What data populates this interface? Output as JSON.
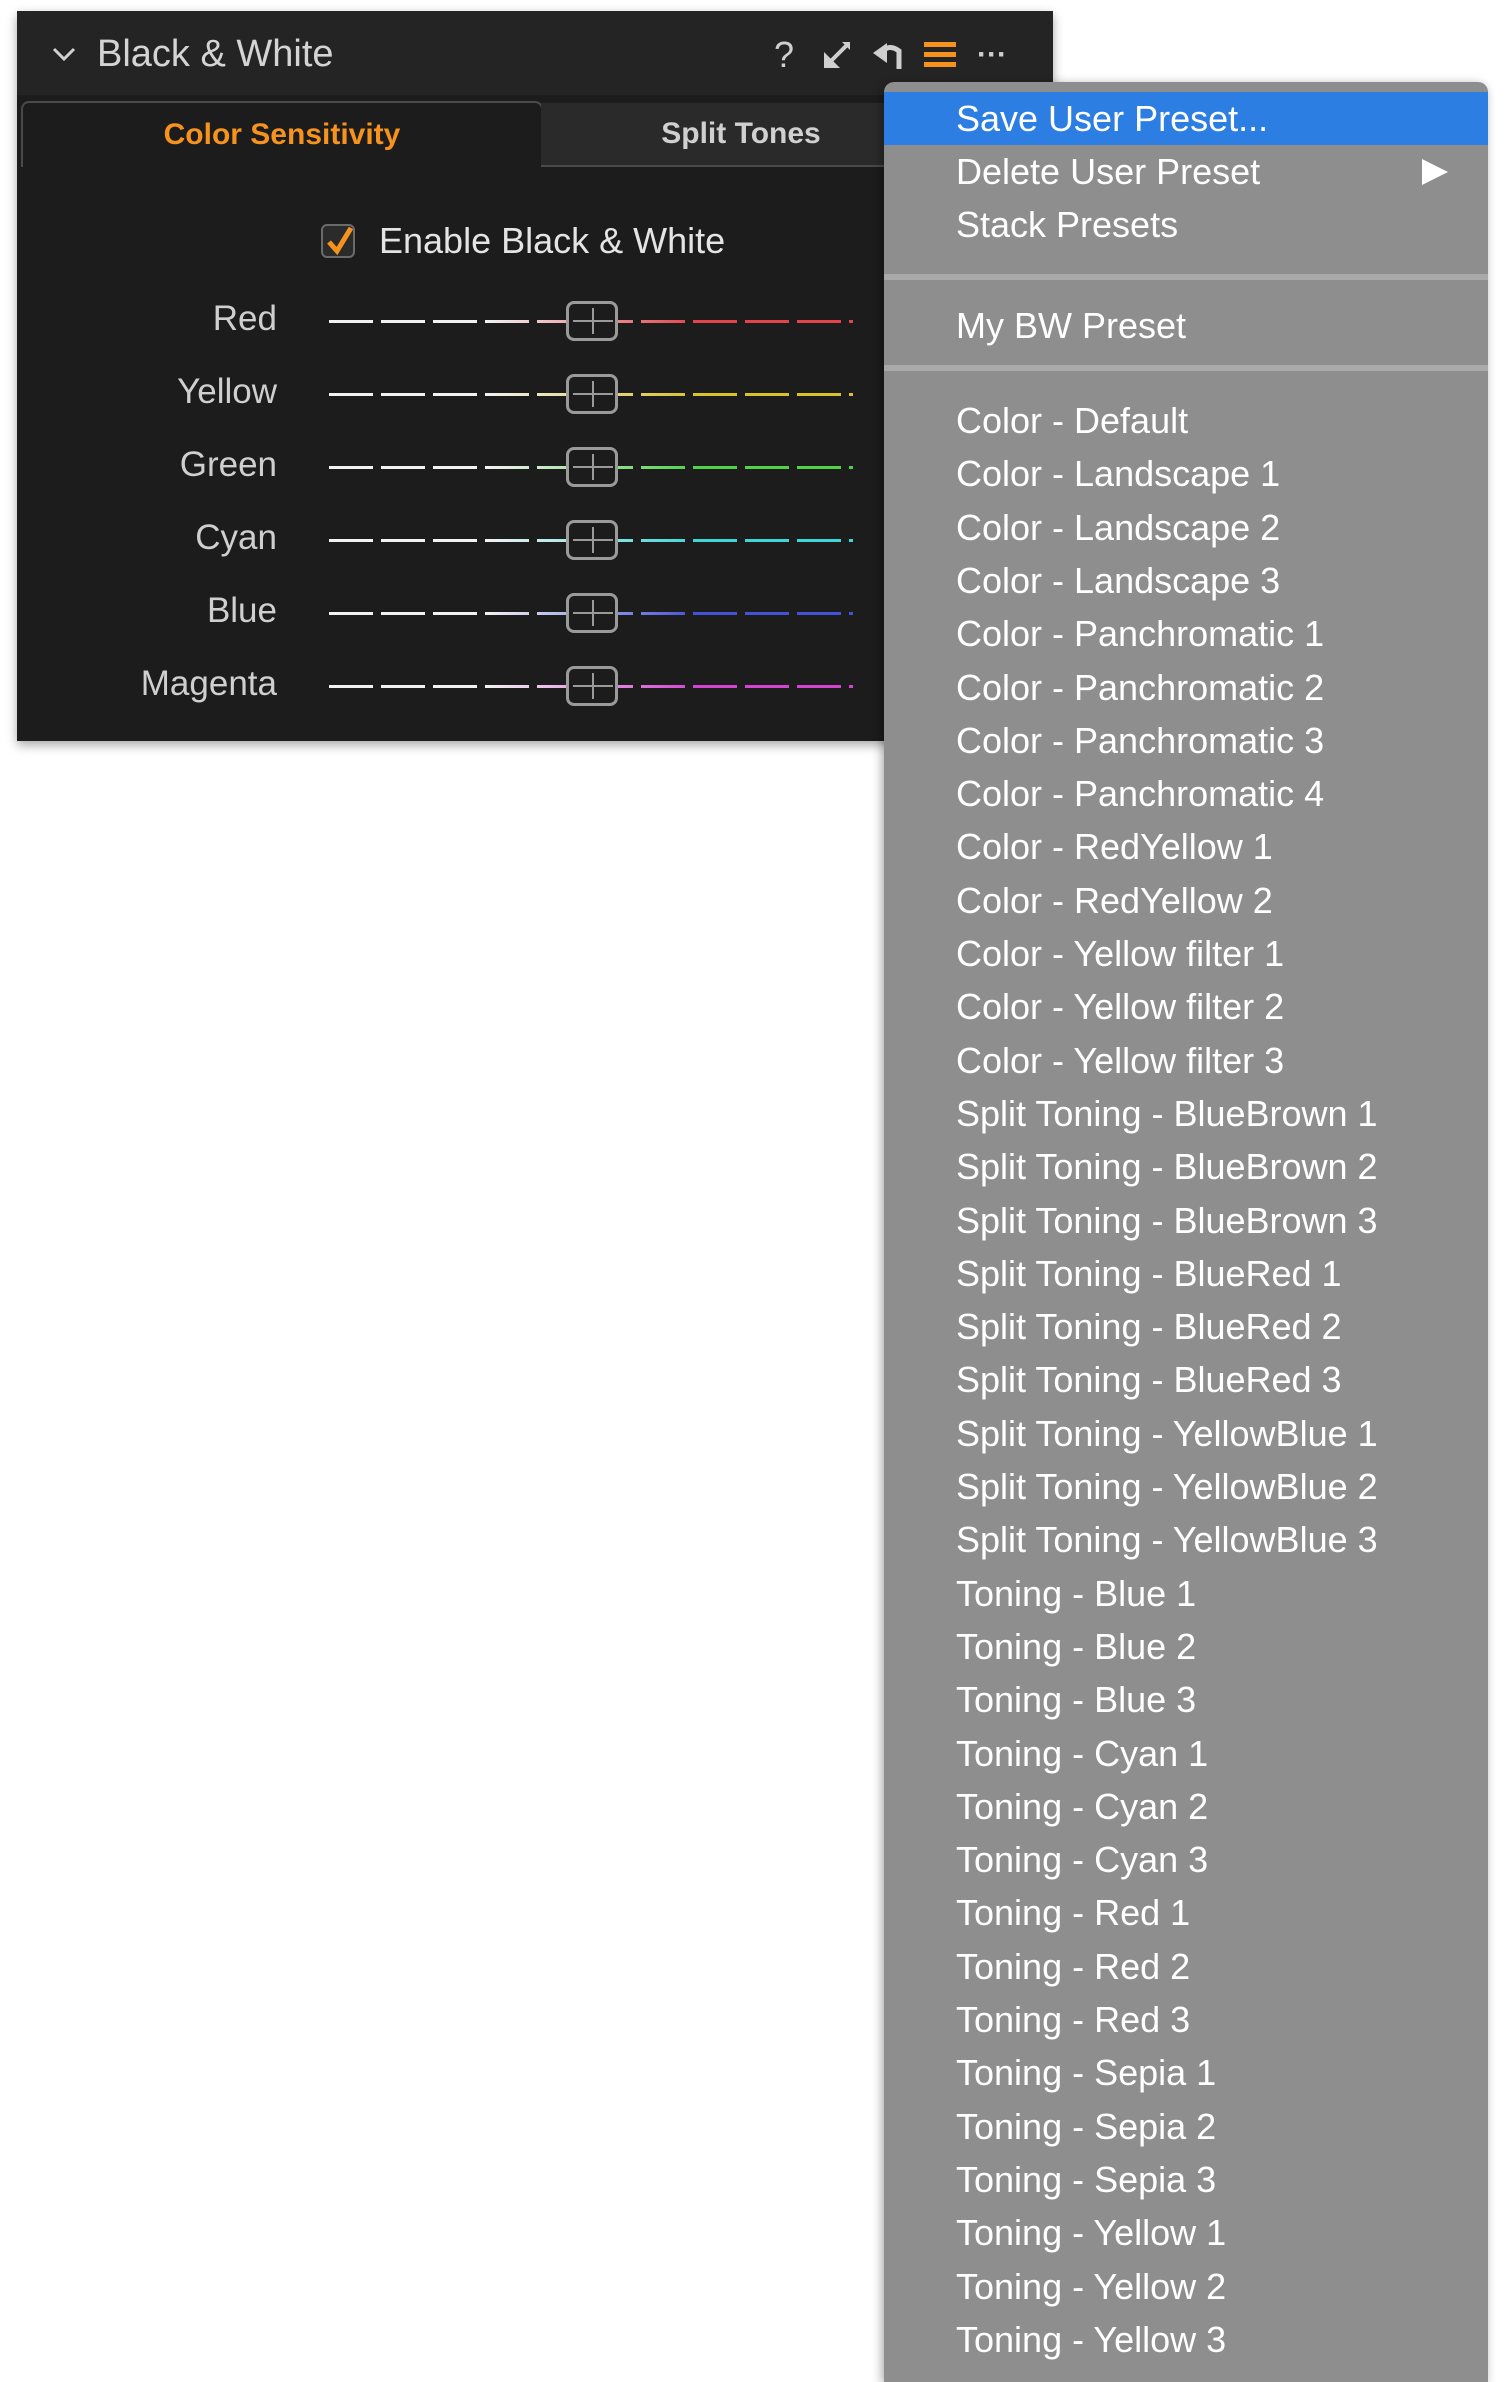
{
  "panel": {
    "title": "Black & White",
    "header_icons": {
      "help": "?",
      "more": "···"
    },
    "tabs": [
      {
        "label": "Color Sensitivity",
        "active": true
      },
      {
        "label": "Split Tones",
        "active": false
      }
    ],
    "enable": {
      "label": "Enable Black & White",
      "checked": true
    },
    "sliders": [
      {
        "label": "Red",
        "value": 0,
        "color": "#e5434b"
      },
      {
        "label": "Yellow",
        "value": 0,
        "color": "#d8c22a"
      },
      {
        "label": "Green",
        "value": 0,
        "color": "#4fd24a"
      },
      {
        "label": "Cyan",
        "value": 0,
        "color": "#3fd6d6"
      },
      {
        "label": "Blue",
        "value": 0,
        "color": "#4451d9"
      },
      {
        "label": "Magenta",
        "value": 0,
        "color": "#d443d4"
      }
    ],
    "colors": {
      "accent": "#f6921e",
      "panel_bg": "#1c1c1c"
    }
  },
  "menu": {
    "highlight_color": "#2c7ee3",
    "top_items": [
      {
        "label": "Save User Preset...",
        "highlighted": true
      },
      {
        "label": "Delete User Preset",
        "submenu": true
      },
      {
        "label": "Stack Presets"
      }
    ],
    "user_presets": [
      "My BW Preset"
    ],
    "presets": [
      "Color - Default",
      "Color - Landscape 1",
      "Color - Landscape 2",
      "Color - Landscape 3",
      "Color - Panchromatic 1",
      "Color - Panchromatic 2",
      "Color - Panchromatic 3",
      "Color - Panchromatic 4",
      "Color - RedYellow 1",
      "Color - RedYellow 2",
      "Color - Yellow filter 1",
      "Color - Yellow filter 2",
      "Color - Yellow filter 3",
      "Split Toning - BlueBrown 1",
      "Split Toning - BlueBrown 2",
      "Split Toning - BlueBrown 3",
      "Split Toning - BlueRed 1",
      "Split Toning - BlueRed 2",
      "Split Toning - BlueRed 3",
      "Split Toning - YellowBlue 1",
      "Split Toning - YellowBlue 2",
      "Split Toning - YellowBlue 3",
      "Toning - Blue 1",
      "Toning - Blue 2",
      "Toning - Blue 3",
      "Toning - Cyan 1",
      "Toning - Cyan 2",
      "Toning - Cyan 3",
      "Toning - Red 1",
      "Toning - Red 2",
      "Toning - Red 3",
      "Toning - Sepia 1",
      "Toning - Sepia 2",
      "Toning - Sepia 3",
      "Toning - Yellow 1",
      "Toning - Yellow 2",
      "Toning - Yellow 3"
    ]
  }
}
